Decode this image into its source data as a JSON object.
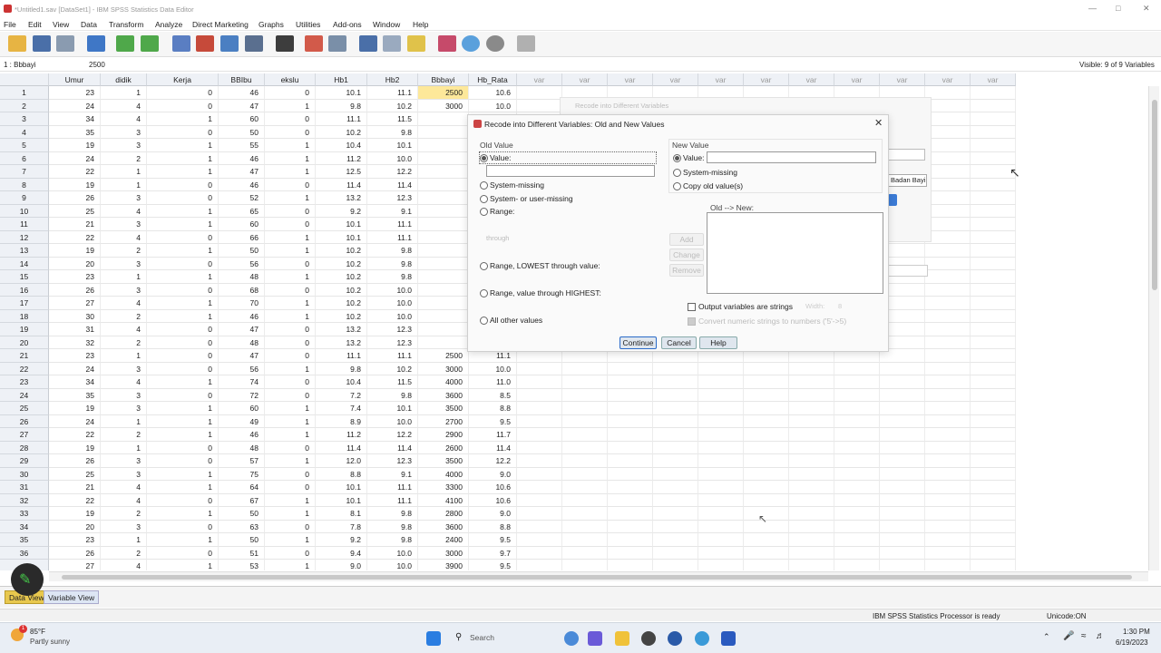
{
  "window": {
    "title": "*Untitled1.sav [DataSet1] - IBM SPSS Statistics Data Editor"
  },
  "menu": [
    "File",
    "Edit",
    "View",
    "Data",
    "Transform",
    "Analyze",
    "Direct Marketing",
    "Graphs",
    "Utilities",
    "Add-ons",
    "Window",
    "Help"
  ],
  "cellbar": {
    "ref": "1 : Bbbayi",
    "value": "2500",
    "visible": "Visible: 9 of 9 Variables"
  },
  "columns": [
    "Umur",
    "didik",
    "Kerja",
    "BBIbu",
    "ekslu",
    "Hb1",
    "Hb2",
    "Bbbayi",
    "Hb_Rata",
    "var",
    "var",
    "var",
    "var",
    "var",
    "var",
    "var",
    "var",
    "var",
    "var",
    "var"
  ],
  "rows": [
    [
      "1",
      "23",
      "1",
      "0",
      "46",
      "0",
      "10.1",
      "11.1",
      "2500",
      "10.6"
    ],
    [
      "2",
      "24",
      "4",
      "0",
      "47",
      "1",
      "9.8",
      "10.2",
      "3000",
      "10.0"
    ],
    [
      "3",
      "34",
      "4",
      "1",
      "60",
      "0",
      "11.1",
      "11.5",
      "",
      ""
    ],
    [
      "4",
      "35",
      "3",
      "0",
      "50",
      "0",
      "10.2",
      "9.8",
      "",
      ""
    ],
    [
      "5",
      "19",
      "3",
      "1",
      "55",
      "1",
      "10.4",
      "10.1",
      "",
      ""
    ],
    [
      "6",
      "24",
      "2",
      "1",
      "46",
      "1",
      "11.2",
      "10.0",
      "",
      ""
    ],
    [
      "7",
      "22",
      "1",
      "1",
      "47",
      "1",
      "12.5",
      "12.2",
      "",
      ""
    ],
    [
      "8",
      "19",
      "1",
      "0",
      "46",
      "0",
      "11.4",
      "11.4",
      "",
      ""
    ],
    [
      "9",
      "26",
      "3",
      "0",
      "52",
      "1",
      "13.2",
      "12.3",
      "",
      ""
    ],
    [
      "10",
      "25",
      "4",
      "1",
      "65",
      "0",
      "9.2",
      "9.1",
      "",
      ""
    ],
    [
      "11",
      "21",
      "3",
      "1",
      "60",
      "0",
      "10.1",
      "11.1",
      "",
      ""
    ],
    [
      "12",
      "22",
      "4",
      "0",
      "66",
      "1",
      "10.1",
      "11.1",
      "",
      ""
    ],
    [
      "13",
      "19",
      "2",
      "1",
      "50",
      "1",
      "10.2",
      "9.8",
      "",
      ""
    ],
    [
      "14",
      "20",
      "3",
      "0",
      "56",
      "0",
      "10.2",
      "9.8",
      "",
      ""
    ],
    [
      "15",
      "23",
      "1",
      "1",
      "48",
      "1",
      "10.2",
      "9.8",
      "",
      ""
    ],
    [
      "16",
      "26",
      "3",
      "0",
      "68",
      "0",
      "10.2",
      "10.0",
      "",
      ""
    ],
    [
      "17",
      "27",
      "4",
      "1",
      "70",
      "1",
      "10.2",
      "10.0",
      "",
      ""
    ],
    [
      "18",
      "30",
      "2",
      "1",
      "46",
      "1",
      "10.2",
      "10.0",
      "",
      ""
    ],
    [
      "19",
      "31",
      "4",
      "0",
      "47",
      "0",
      "13.2",
      "12.3",
      "",
      ""
    ],
    [
      "20",
      "32",
      "2",
      "0",
      "48",
      "0",
      "13.2",
      "12.3",
      "",
      ""
    ],
    [
      "21",
      "23",
      "1",
      "0",
      "47",
      "0",
      "11.1",
      "11.1",
      "2500",
      "11.1"
    ],
    [
      "22",
      "24",
      "3",
      "0",
      "56",
      "1",
      "9.8",
      "10.2",
      "3000",
      "10.0"
    ],
    [
      "23",
      "34",
      "4",
      "1",
      "74",
      "0",
      "10.4",
      "11.5",
      "4000",
      "11.0"
    ],
    [
      "24",
      "35",
      "3",
      "0",
      "72",
      "0",
      "7.2",
      "9.8",
      "3600",
      "8.5"
    ],
    [
      "25",
      "19",
      "3",
      "1",
      "60",
      "1",
      "7.4",
      "10.1",
      "3500",
      "8.8"
    ],
    [
      "26",
      "24",
      "1",
      "1",
      "49",
      "1",
      "8.9",
      "10.0",
      "2700",
      "9.5"
    ],
    [
      "27",
      "22",
      "2",
      "1",
      "46",
      "1",
      "11.2",
      "12.2",
      "2900",
      "11.7"
    ],
    [
      "28",
      "19",
      "1",
      "0",
      "48",
      "0",
      "11.4",
      "11.4",
      "2600",
      "11.4"
    ],
    [
      "29",
      "26",
      "3",
      "0",
      "57",
      "1",
      "12.0",
      "12.3",
      "3500",
      "12.2"
    ],
    [
      "30",
      "25",
      "3",
      "1",
      "75",
      "0",
      "8.8",
      "9.1",
      "4000",
      "9.0"
    ],
    [
      "31",
      "21",
      "4",
      "1",
      "64",
      "0",
      "10.1",
      "11.1",
      "3300",
      "10.6"
    ],
    [
      "32",
      "22",
      "4",
      "0",
      "67",
      "1",
      "10.1",
      "11.1",
      "4100",
      "10.6"
    ],
    [
      "33",
      "19",
      "2",
      "1",
      "50",
      "1",
      "8.1",
      "9.8",
      "2800",
      "9.0"
    ],
    [
      "34",
      "20",
      "3",
      "0",
      "63",
      "0",
      "7.8",
      "9.8",
      "3600",
      "8.8"
    ],
    [
      "35",
      "23",
      "1",
      "1",
      "50",
      "1",
      "9.2",
      "9.8",
      "2400",
      "9.5"
    ],
    [
      "36",
      "26",
      "2",
      "0",
      "51",
      "0",
      "9.4",
      "10.0",
      "3000",
      "9.7"
    ],
    [
      "",
      "27",
      "4",
      "1",
      "53",
      "1",
      "9.0",
      "10.0",
      "3900",
      "9.5"
    ]
  ],
  "bg_dialog": {
    "title": "Recode into Different Variables",
    "field_text": "Badan Bayi"
  },
  "dialog": {
    "title": "Recode into Different Variables: Old and New Values",
    "old_value": {
      "group": "Old Value",
      "value": "Value:",
      "system_missing": "System-missing",
      "system_user_missing": "System- or user-missing",
      "range": "Range:",
      "through": "through",
      "range_lowest": "Range, LOWEST through value:",
      "range_highest": "Range, value through HIGHEST:",
      "all_other": "All other values"
    },
    "new_value": {
      "group": "New Value",
      "value": "Value:",
      "system_missing": "System-missing",
      "copy_old": "Copy old value(s)"
    },
    "old_new_label": "Old --> New:",
    "add": "Add",
    "change": "Change",
    "remove": "Remove",
    "output_strings": "Output variables are strings",
    "width": "Width:",
    "width_value": "8",
    "convert_numeric": "Convert numeric strings to numbers ('5'->5)",
    "continue": "Continue",
    "cancel": "Cancel",
    "help": "Help"
  },
  "tabs": {
    "data_view": "Data View",
    "variable_view": "Variable View"
  },
  "status": {
    "processor": "IBM SPSS Statistics Processor is ready",
    "unicode": "Unicode:ON"
  },
  "taskbar": {
    "temp": "85°F",
    "weather": "Partly sunny",
    "search": "Search",
    "time": "1:30 PM",
    "date": "6/19/2023",
    "badge": "1"
  }
}
